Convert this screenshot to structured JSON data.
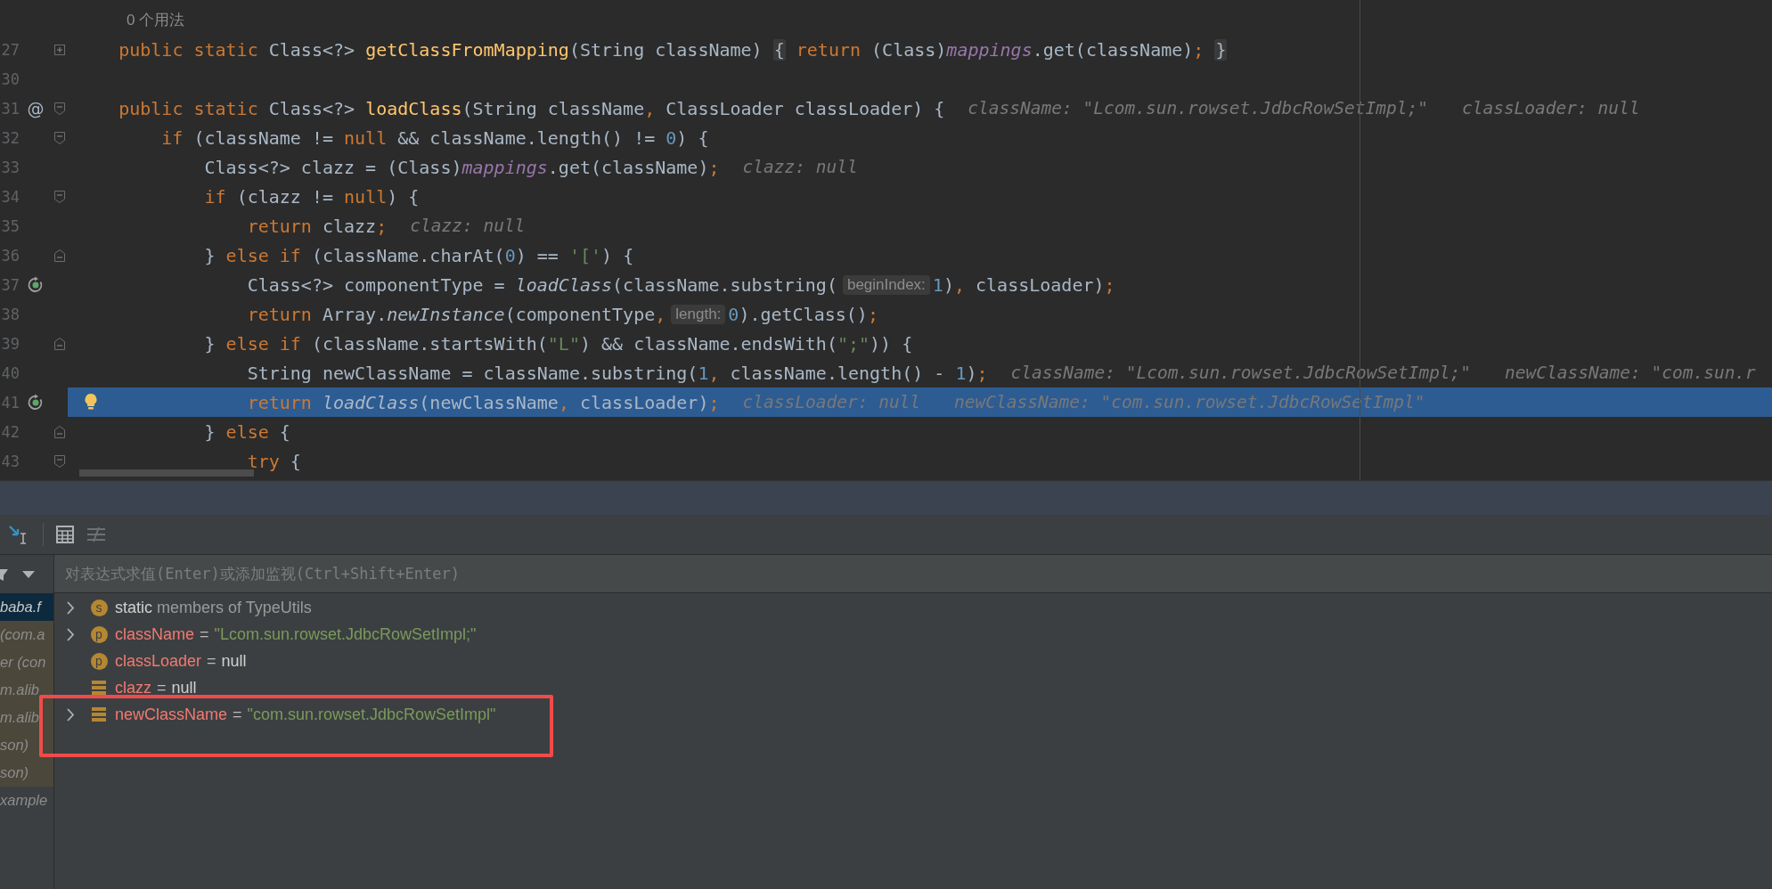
{
  "editor": {
    "usage_hint": "0 个用法",
    "lines": [
      {
        "number": "27",
        "fold": {
          "kind": "expand"
        },
        "tokens": [
          {
            "kind": "kw",
            "t": "    public static "
          },
          {
            "kind": "plain",
            "t": "Class<?> "
          },
          {
            "kind": "decl",
            "t": "getClassFromMapping"
          },
          {
            "kind": "plain",
            "t": "(String className) "
          },
          {
            "kind": "fold",
            "t": "{"
          },
          {
            "kind": "kw",
            "t": " return "
          },
          {
            "kind": "plain",
            "t": "(Class)"
          },
          {
            "kind": "field",
            "t": "mappings"
          },
          {
            "kind": "plain",
            "t": ".get(className)"
          },
          {
            "kind": "punct",
            "t": "; "
          },
          {
            "kind": "fold",
            "t": "}"
          }
        ]
      },
      {
        "number": "30"
      },
      {
        "number": "31",
        "gutter_text": "@",
        "fold": {
          "kind": "start"
        },
        "tokens": [
          {
            "kind": "kw",
            "t": "    public static "
          },
          {
            "kind": "plain",
            "t": "Class<?> "
          },
          {
            "kind": "decl",
            "t": "loadClass"
          },
          {
            "kind": "plain",
            "t": "(String className"
          },
          {
            "kind": "punct",
            "t": ","
          },
          {
            "kind": "plain",
            "t": " ClassLoader classLoader) {"
          },
          {
            "kind": "hint",
            "t": "className: \"Lcom.sun.rowset.JdbcRowSetImpl;\""
          },
          {
            "kind": "hint",
            "t": "classLoader: null"
          }
        ]
      },
      {
        "number": "32",
        "fold": {
          "kind": "start"
        },
        "tokens": [
          {
            "kind": "kw",
            "t": "        if "
          },
          {
            "kind": "plain",
            "t": "(className != "
          },
          {
            "kind": "kw",
            "t": "null"
          },
          {
            "kind": "plain",
            "t": " && className.length() != "
          },
          {
            "kind": "num",
            "t": "0"
          },
          {
            "kind": "plain",
            "t": ") {"
          }
        ]
      },
      {
        "number": "33",
        "tokens": [
          {
            "kind": "plain",
            "t": "            Class<?> clazz = (Class)"
          },
          {
            "kind": "field",
            "t": "mappings"
          },
          {
            "kind": "plain",
            "t": ".get(className)"
          },
          {
            "kind": "punct",
            "t": ";"
          },
          {
            "kind": "hint",
            "t": "clazz: null"
          }
        ]
      },
      {
        "number": "34",
        "fold": {
          "kind": "start"
        },
        "tokens": [
          {
            "kind": "kw",
            "t": "            if "
          },
          {
            "kind": "plain",
            "t": "(clazz != "
          },
          {
            "kind": "kw",
            "t": "null"
          },
          {
            "kind": "plain",
            "t": ") {"
          }
        ]
      },
      {
        "number": "35",
        "tokens": [
          {
            "kind": "kw",
            "t": "                return "
          },
          {
            "kind": "plain",
            "t": "clazz"
          },
          {
            "kind": "punct",
            "t": ";"
          },
          {
            "kind": "hint",
            "t": "clazz: null"
          }
        ]
      },
      {
        "number": "36",
        "fold": {
          "kind": "end"
        },
        "tokens": [
          {
            "kind": "plain",
            "t": "            } "
          },
          {
            "kind": "kw",
            "t": "else if "
          },
          {
            "kind": "plain",
            "t": "(className.charAt("
          },
          {
            "kind": "num",
            "t": "0"
          },
          {
            "kind": "plain",
            "t": ") == "
          },
          {
            "kind": "str",
            "t": "'['"
          },
          {
            "kind": "plain",
            "t": ") {"
          }
        ]
      },
      {
        "number": "37",
        "gutter_icon": {
          "kind": "drop-frame"
        },
        "tokens": [
          {
            "kind": "plain",
            "t": "                Class<?> componentType = "
          },
          {
            "kind": "call",
            "t": "loadClass"
          },
          {
            "kind": "plain",
            "t": "(className.substring("
          },
          {
            "kind": "param",
            "t": "beginIndex:"
          },
          {
            "kind": "num",
            "t": "1"
          },
          {
            "kind": "plain",
            "t": ")"
          },
          {
            "kind": "punct",
            "t": ","
          },
          {
            "kind": "plain",
            "t": " classLoader)"
          },
          {
            "kind": "punct",
            "t": ";"
          }
        ]
      },
      {
        "number": "38",
        "tokens": [
          {
            "kind": "kw",
            "t": "                return "
          },
          {
            "kind": "plain",
            "t": "Array."
          },
          {
            "kind": "call",
            "t": "newInstance"
          },
          {
            "kind": "plain",
            "t": "(componentType"
          },
          {
            "kind": "punct",
            "t": ","
          },
          {
            "kind": "param",
            "t": "length:"
          },
          {
            "kind": "num",
            "t": "0"
          },
          {
            "kind": "plain",
            "t": ").getClass()"
          },
          {
            "kind": "punct",
            "t": ";"
          }
        ]
      },
      {
        "number": "39",
        "fold": {
          "kind": "end"
        },
        "tokens": [
          {
            "kind": "plain",
            "t": "            } "
          },
          {
            "kind": "kw",
            "t": "else if "
          },
          {
            "kind": "plain",
            "t": "(className.startsWith("
          },
          {
            "kind": "str",
            "t": "\"L\""
          },
          {
            "kind": "plain",
            "t": ") && className.endsWith("
          },
          {
            "kind": "str",
            "t": "\";\""
          },
          {
            "kind": "plain",
            "t": ")) {"
          }
        ]
      },
      {
        "number": "40",
        "tokens": [
          {
            "kind": "plain",
            "t": "                String newClassName = className.substring("
          },
          {
            "kind": "num",
            "t": "1"
          },
          {
            "kind": "punct",
            "t": ","
          },
          {
            "kind": "plain",
            "t": " className.length() - "
          },
          {
            "kind": "num",
            "t": "1"
          },
          {
            "kind": "plain",
            "t": ")"
          },
          {
            "kind": "punct",
            "t": ";"
          },
          {
            "kind": "hint",
            "t": "className: \"Lcom.sun.rowset.JdbcRowSetImpl;\""
          },
          {
            "kind": "hint",
            "t": "newClassName: \"com.sun.r"
          }
        ]
      },
      {
        "number": "41",
        "current": true,
        "bulb": true,
        "gutter_icon": {
          "kind": "drop-frame"
        },
        "tokens": [
          {
            "kind": "kw",
            "t": "                return "
          },
          {
            "kind": "call",
            "t": "loadClass"
          },
          {
            "kind": "plain",
            "t": "(newClassName"
          },
          {
            "kind": "punct",
            "t": ","
          },
          {
            "kind": "plain",
            "t": " classLoader)"
          },
          {
            "kind": "punct",
            "t": ";"
          },
          {
            "kind": "hint",
            "t": "classLoader: null"
          },
          {
            "kind": "hint",
            "t": "newClassName: \"com.sun.rowset.JdbcRowSetImpl\""
          }
        ]
      },
      {
        "number": "42",
        "fold": {
          "kind": "end"
        },
        "tokens": [
          {
            "kind": "plain",
            "t": "            } "
          },
          {
            "kind": "kw",
            "t": "else"
          },
          {
            "kind": "plain",
            "t": " {"
          }
        ]
      },
      {
        "number": "43",
        "fold": {
          "kind": "start"
        },
        "tokens": [
          {
            "kind": "kw",
            "t": "                try"
          },
          {
            "kind": "plain",
            "t": " {"
          }
        ]
      }
    ]
  },
  "debugger": {
    "evaluate": {
      "placeholder": "对表达式求值(Enter)或添加监视(Ctrl+Shift+Enter)"
    },
    "frames": [
      {
        "text": "baba.f",
        "selected": true,
        "library": false
      },
      {
        "text": "(com.a",
        "selected": false,
        "library": true
      },
      {
        "text": "er (con",
        "selected": false,
        "library": true
      },
      {
        "text": "m.alib",
        "selected": false,
        "library": true
      },
      {
        "text": "m.alib",
        "selected": false,
        "library": true
      },
      {
        "text": "son)",
        "selected": false,
        "library": true
      },
      {
        "text": "son)",
        "selected": false,
        "library": true
      },
      {
        "text": "xample",
        "selected": false,
        "library": false
      }
    ],
    "variables": [
      {
        "kind": "static",
        "badge": "s",
        "expandable": true,
        "annotated": false,
        "name": "static",
        "value": "members of TypeUtils",
        "string_value": false
      },
      {
        "kind": "param",
        "badge": "p",
        "expandable": true,
        "annotated": false,
        "name": "className",
        "eq": "=",
        "value": "\"Lcom.sun.rowset.JdbcRowSetImpl;\"",
        "string_value": true
      },
      {
        "kind": "param",
        "badge": "p",
        "expandable": false,
        "annotated": false,
        "name": "classLoader",
        "eq": "=",
        "value": "null",
        "string_value": false
      },
      {
        "kind": "local",
        "expandable": false,
        "annotated": false,
        "name": "clazz",
        "eq": "=",
        "value": "null",
        "string_value": false
      },
      {
        "kind": "local",
        "expandable": true,
        "annotated": true,
        "name": "newClassName",
        "eq": "=",
        "value": "\"com.sun.rowset.JdbcRowSetImpl\"",
        "string_value": true
      }
    ]
  }
}
